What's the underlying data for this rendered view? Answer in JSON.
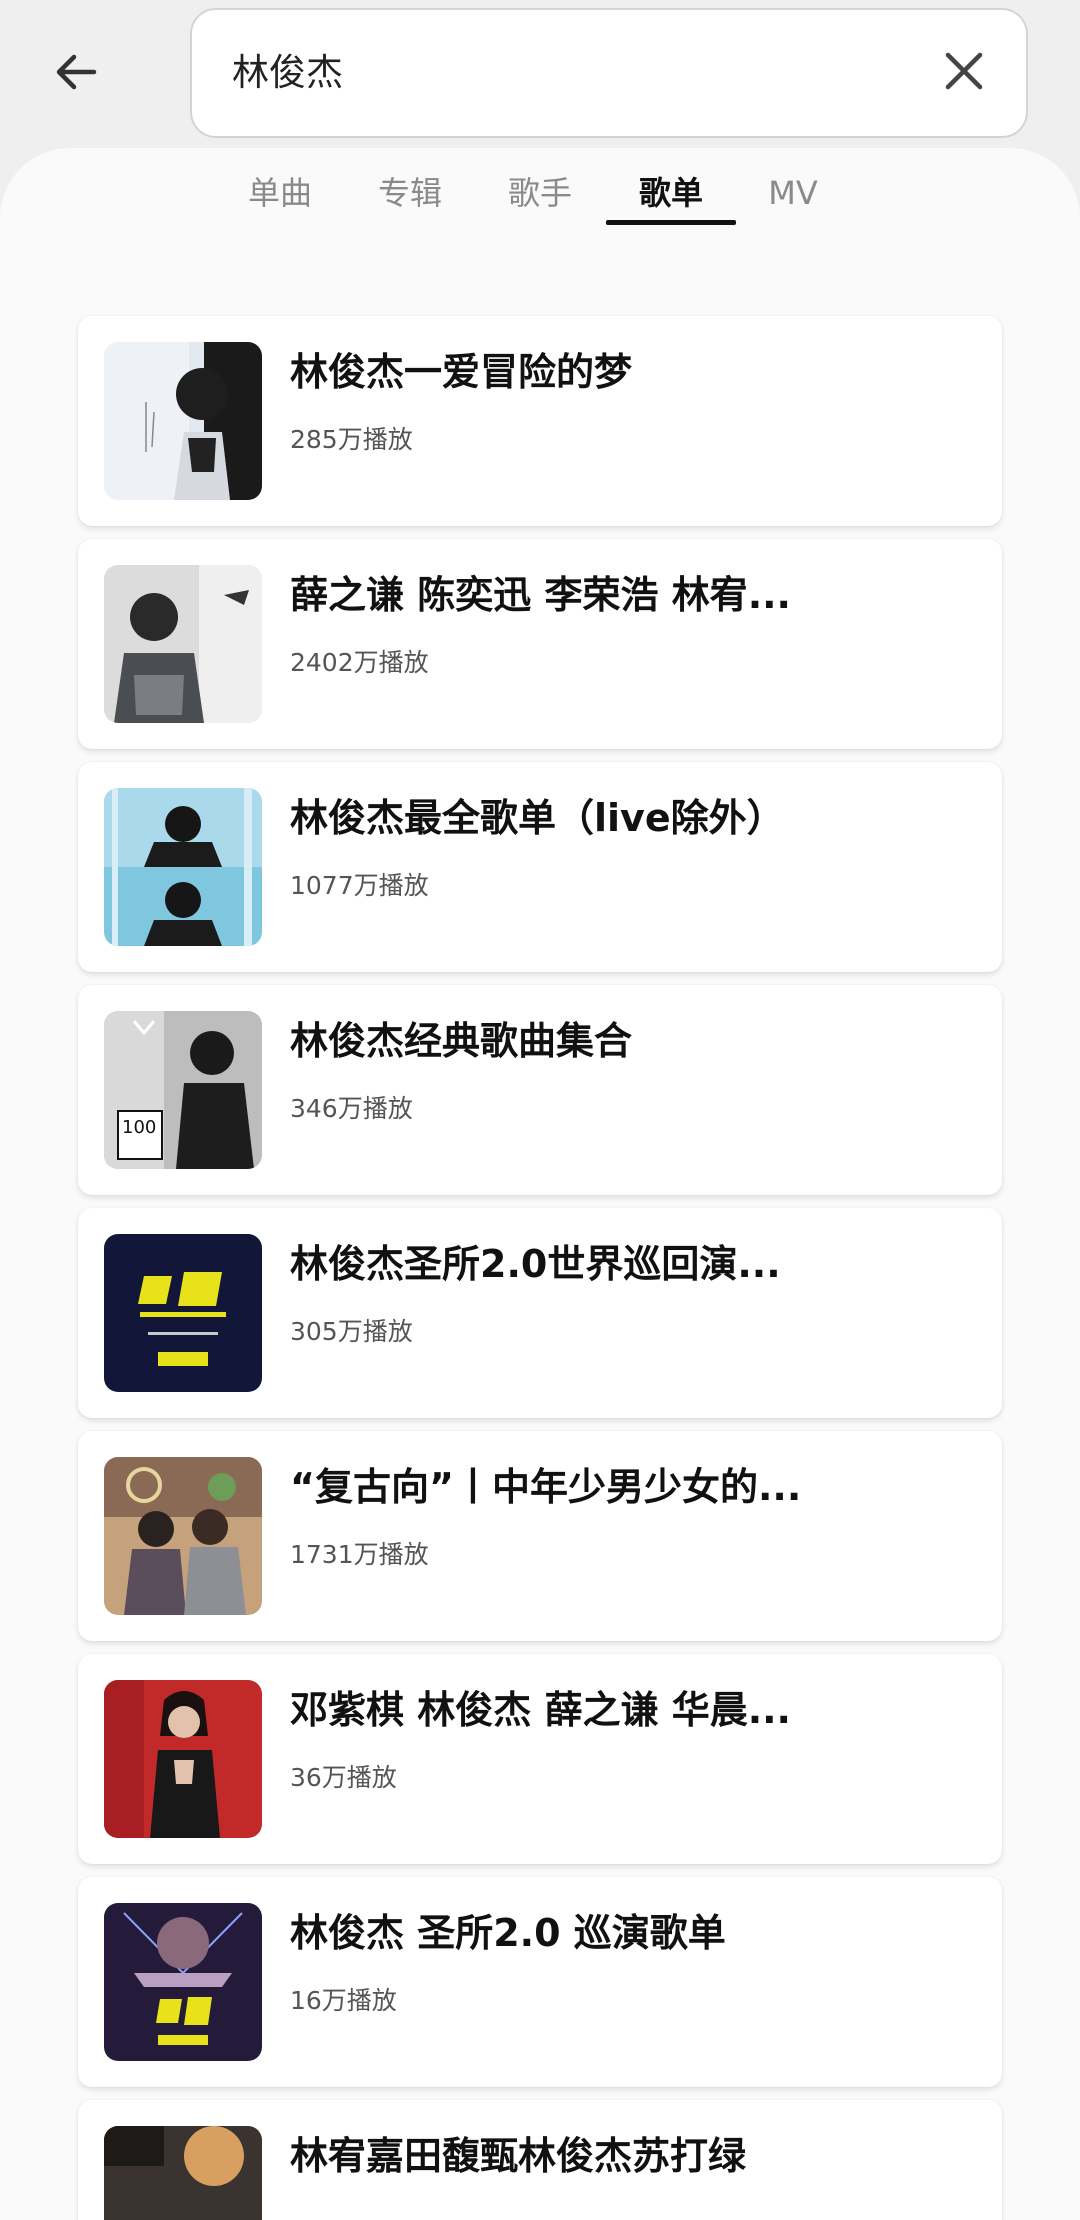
{
  "search": {
    "query": "林俊杰"
  },
  "tabs": [
    {
      "label": "单曲"
    },
    {
      "label": "专辑"
    },
    {
      "label": "歌手"
    },
    {
      "label": "歌单"
    },
    {
      "label": "MV"
    }
  ],
  "active_tab": "歌单",
  "playlists": [
    {
      "title": "林俊杰一爱冒险的梦",
      "plays": "285万播放"
    },
    {
      "title": "薛之谦 陈奕迅 李荣浩 林宥...",
      "plays": "2402万播放"
    },
    {
      "title": "林俊杰最全歌单（live除外）",
      "plays": "1077万播放"
    },
    {
      "title": "林俊杰经典歌曲集合",
      "plays": "346万播放"
    },
    {
      "title": "林俊杰圣所2.0世界巡回演...",
      "plays": "305万播放"
    },
    {
      "title": "“复古向”丨中年少男少女的...",
      "plays": "1731万播放"
    },
    {
      "title": "邓紫棋 林俊杰 薛之谦 华晨...",
      "plays": "36万播放"
    },
    {
      "title": "林俊杰 圣所2.0 巡演歌单",
      "plays": "16万播放"
    },
    {
      "title": "林宥嘉田馥甄林俊杰苏打绿",
      "plays": ""
    }
  ],
  "colors": {
    "accent": "#111111",
    "background": "#efefef",
    "card": "#ffffff"
  }
}
